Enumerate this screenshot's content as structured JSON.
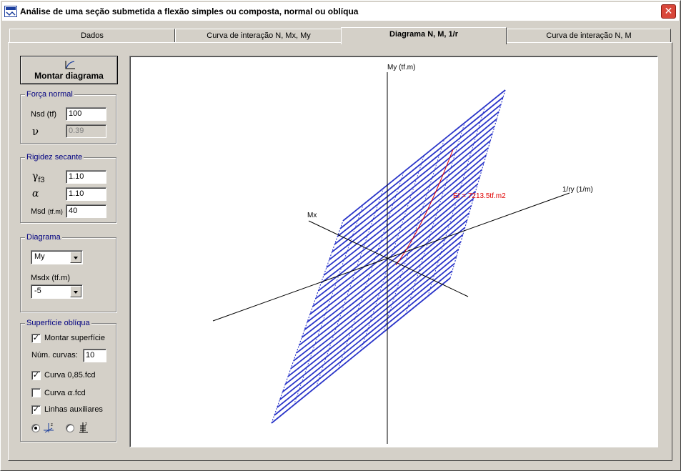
{
  "window": {
    "title": "Análise de uma seção submetida a flexão simples ou composta, normal ou oblíqua",
    "close_glyph": "✕"
  },
  "tabs": [
    {
      "label": "Dados",
      "active": false
    },
    {
      "label": "Curva de interação N, Mx, My",
      "active": false
    },
    {
      "label": "Diagrama N, M, 1/r",
      "active": true
    },
    {
      "label": "Curva de interação N, M",
      "active": false
    }
  ],
  "toolbar": {
    "montar_label": "Montar diagrama",
    "montar_icon": "chart-curve-icon"
  },
  "forca_normal": {
    "legend": "Força normal",
    "nsd_label": "Nsd (tf)",
    "nsd_value": "100",
    "nu_label": "ν",
    "nu_value": "0.39"
  },
  "rigidez": {
    "legend": "Rigidez secante",
    "gamma_label": "γ",
    "gamma_sub": "f3",
    "gamma_value": "1.10",
    "alpha_label": "α",
    "alpha_value": "1.10",
    "msd_label": "Msd",
    "msd_unit": "(tf.m)",
    "msd_value": "40"
  },
  "diagrama": {
    "legend": "Diagrama",
    "selected": "My",
    "msdx_label": "Msdx (tf.m)",
    "msdx_value": "-5"
  },
  "superficie": {
    "legend": "Superfície oblíqua",
    "montar_label": "Montar superfície",
    "montar_checked": true,
    "num_curvas_label": "Núm. curvas:",
    "num_curvas_value": "10",
    "curva085_label": "Curva 0,85.fcd",
    "curva085_checked": true,
    "curva_alpha_label": "Curva ",
    "curva_alpha_symbol": "α",
    "curva_alpha_suffix": ".fcd",
    "curva_alpha_checked": false,
    "linhas_label": "Linhas auxiliares",
    "linhas_checked": true,
    "radio1_icon": "axis-z-top-icon",
    "radio1_selected": true,
    "radio2_icon": "axis-z-side-icon",
    "radio2_selected": false
  },
  "plot": {
    "axis_my": "My (tf.m)",
    "axis_ry": "1/ry (1/m)",
    "axis_mx": "Mx",
    "ei_label": "EI = 7213.5tf.m2",
    "surface_color": "#2a35c9",
    "ei_color": "#e00000"
  }
}
